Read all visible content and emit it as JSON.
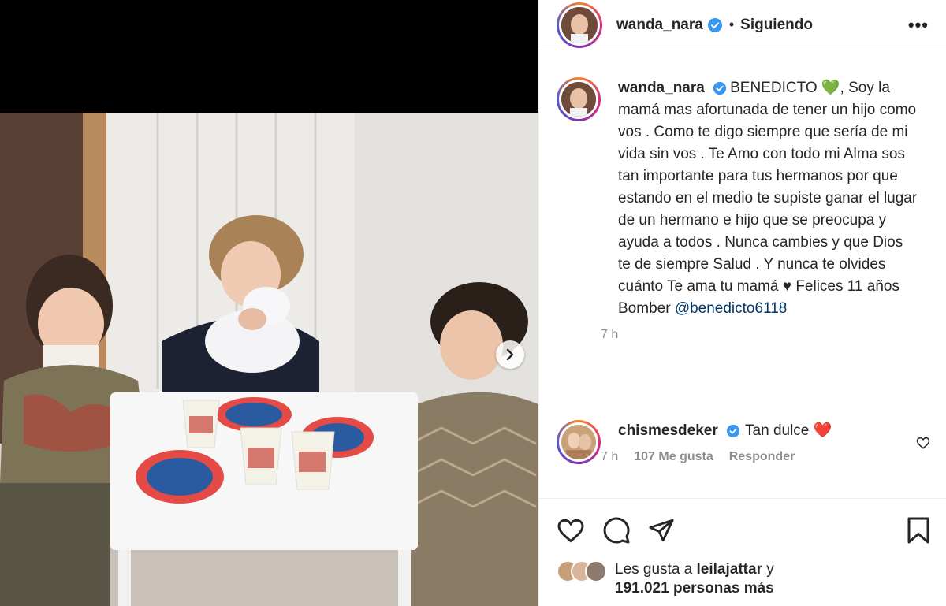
{
  "post": {
    "username": "wanda_nara",
    "follow_status": "Siguiendo",
    "separator": "•",
    "more_glyph": "•••"
  },
  "caption": {
    "username": "wanda_nara",
    "text": "BENEDICTO 💚, Soy la mamá mas afortunada de tener un hijo como vos . Como te digo siempre que sería de mi vida sin vos . Te Amo con todo mi Alma sos tan importante para tus hermanos por que estando en el medio te supiste ganar el lugar de un hermano e hijo que se preocupa y ayuda a todos . Nunca cambies y que Dios te de siempre Salud . Y nunca te olvides cuánto Te ama tu mamá ♥ Felices 11 años Bomber ",
    "mention": "@benedicto6118",
    "time": "7 h"
  },
  "comment": {
    "username": "chismesdeker",
    "text": "Tan dulce ❤️",
    "time": "7 h",
    "likes": "107 Me gusta",
    "reply": "Responder"
  },
  "likes": {
    "prefix": "Les gusta a ",
    "user": "leilajattar",
    "middle": " y",
    "count": "191.021 personas más"
  },
  "icons": {
    "verified": "verified-badge-icon",
    "more": "more-options-icon",
    "next": "chevron-right-icon",
    "like": "heart-icon",
    "comment": "comment-bubble-icon",
    "share": "paper-plane-icon",
    "save": "bookmark-icon"
  },
  "colors": {
    "verified": "#3897f0",
    "mention": "#00376b",
    "muted": "#8e8e8e",
    "heart": "#ed4956"
  }
}
